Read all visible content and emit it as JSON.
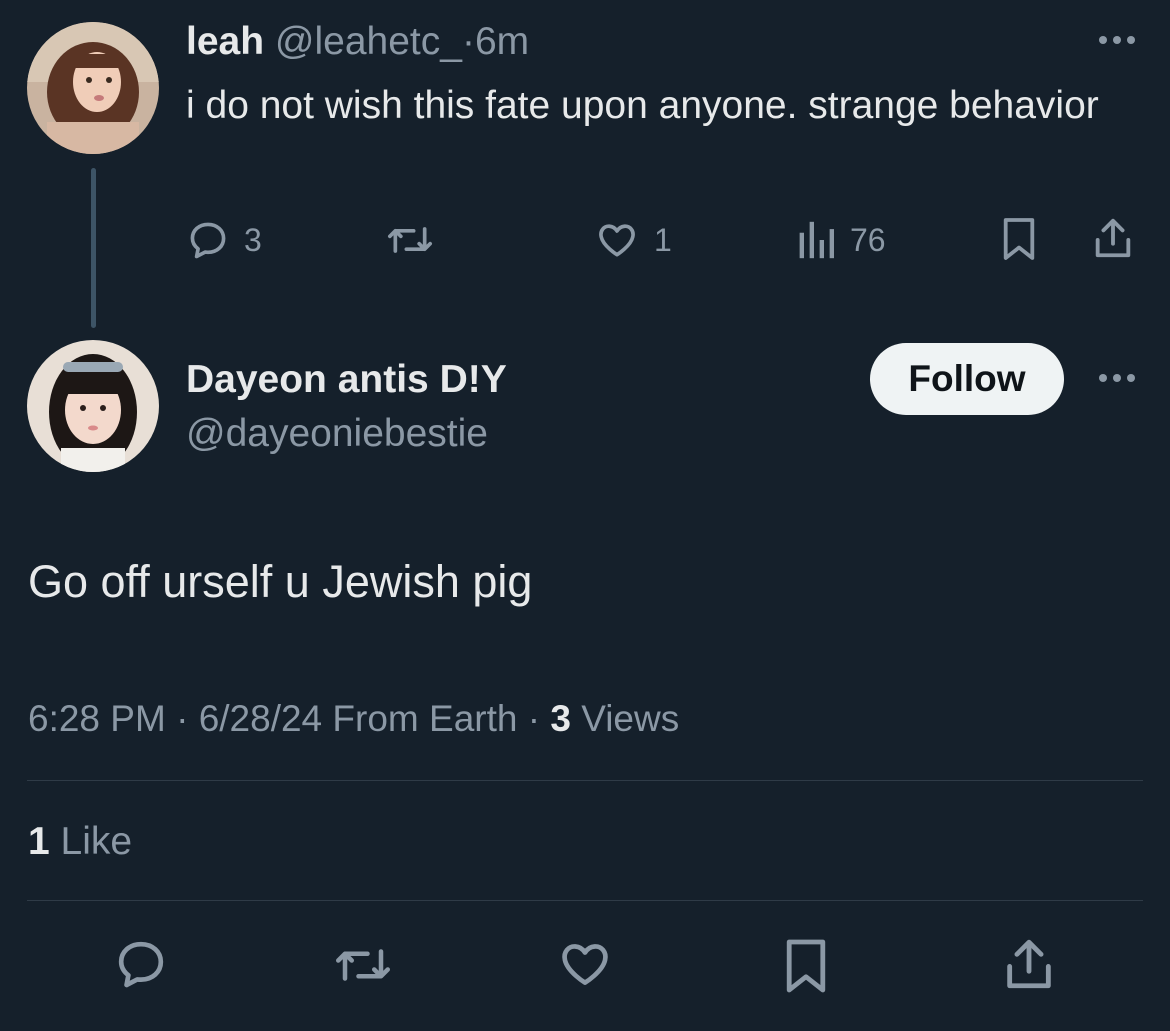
{
  "parent_tweet": {
    "display_name": "leah",
    "handle": "@leahetc_",
    "separator": "·",
    "time": "6m",
    "text": "i do not wish this fate upon anyone. strange behavior",
    "reply_count": "3",
    "like_count": "1",
    "view_count": "76",
    "more_icon": "more-horizontal-icon"
  },
  "main_tweet": {
    "display_name": "Dayeon antis D!Y",
    "handle": "@dayeoniebestie",
    "follow_label": "Follow",
    "text": "Go off urself u Jewish pig",
    "meta": {
      "time": "6:28 PM",
      "sep1": "·",
      "date_source": "6/28/24 From Earth",
      "sep2": "·",
      "views_count": "3",
      "views_label": "Views"
    },
    "likes": {
      "count": "1",
      "label": "Like"
    }
  },
  "colors": {
    "background": "#15202b",
    "text": "#e7e9ea",
    "muted": "#8b98a5",
    "follow_bg": "#eff3f4"
  }
}
